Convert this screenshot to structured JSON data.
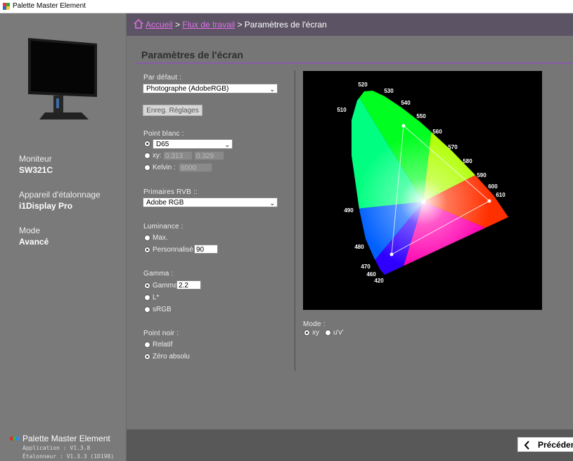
{
  "window": {
    "title": "Palette Master Element"
  },
  "sidebar": {
    "monitor_label": "Moniteur",
    "monitor_value": "SW321C",
    "device_label": "Appareil d'étalonnage",
    "device_value": "i1Display Pro",
    "mode_label": "Mode",
    "mode_value": "Avancé",
    "brand": "Palette Master Element",
    "app_version": "Application   : V1.3.8",
    "cal_version": "Étalonneur  : V1.3.3 (1D198)"
  },
  "breadcrumb": {
    "home": "Accueil",
    "workflow": "Flux de travail",
    "current": "Paramètres de l'écran",
    "sep": ">"
  },
  "page": {
    "title": "Paramètres de l'écran"
  },
  "settings": {
    "default_label": "Par défaut :",
    "default_value": "Photographe (AdobeRGB)",
    "save_button": "Enreg. Réglages",
    "white_label": "Point blanc :",
    "white_d65": "D65",
    "white_xy": "xy:",
    "white_x": "0.313",
    "white_y": "0.329",
    "white_kelvin": "Kelvin :",
    "white_kelvin_value": "6000",
    "primaries_label": "Primaires RVB ::",
    "primaries_value": "Adobe RGB",
    "lum_label": "Luminance :",
    "lum_max": "Max.",
    "lum_custom": "Personnalisé",
    "lum_value": "90",
    "gamma_label": "Gamma :",
    "gamma_opt": "Gamma",
    "gamma_value": "2.2",
    "gamma_l": "L*",
    "gamma_srgb": "sRGB",
    "black_label": "Point noir  :",
    "black_rel": "Relatif",
    "black_abs": "Zéro absolu"
  },
  "chart": {
    "mode_label": "Mode :",
    "mode_xy": "xy",
    "mode_uv": "u'v'",
    "wavelengths": [
      "520",
      "530",
      "540",
      "550",
      "560",
      "570",
      "580",
      "590",
      "600",
      "610",
      "510",
      "490",
      "480",
      "470",
      "460",
      "420"
    ]
  },
  "footer": {
    "prev": "Précédent"
  }
}
